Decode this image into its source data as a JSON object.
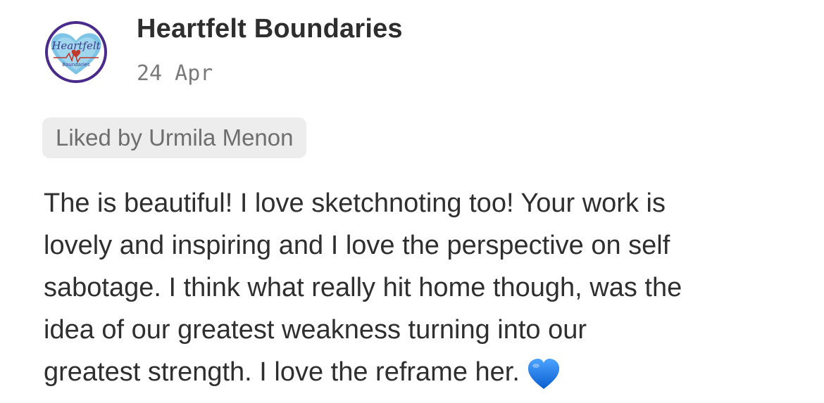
{
  "comment": {
    "author": "Heartfelt Boundaries",
    "date": "24 Apr",
    "liked_by": "Liked by Urmila Menon",
    "body_lines": [
      "The is beautiful! I love sketchnoting too! Your work is",
      "lovely and inspiring and I love the perspective on self",
      "sabotage. I think what really hit home though, was the",
      "idea of our greatest weakness turning into our",
      "greatest strength. I love the reframe her."
    ],
    "emoji": "blue-heart-icon",
    "avatar_logo_text": "Heartfelt",
    "avatar_logo_subtext": "Boundaries"
  },
  "colors": {
    "author": "#2e2e2e",
    "date": "#7a7a7a",
    "liked_pill_bg": "#ededed",
    "liked_text": "#6e6e6e",
    "body_text": "#2f2f2f",
    "heart": "#1f7fe0",
    "avatar_ring": "#4a2a8a",
    "avatar_heart": "#7ec4e6"
  }
}
